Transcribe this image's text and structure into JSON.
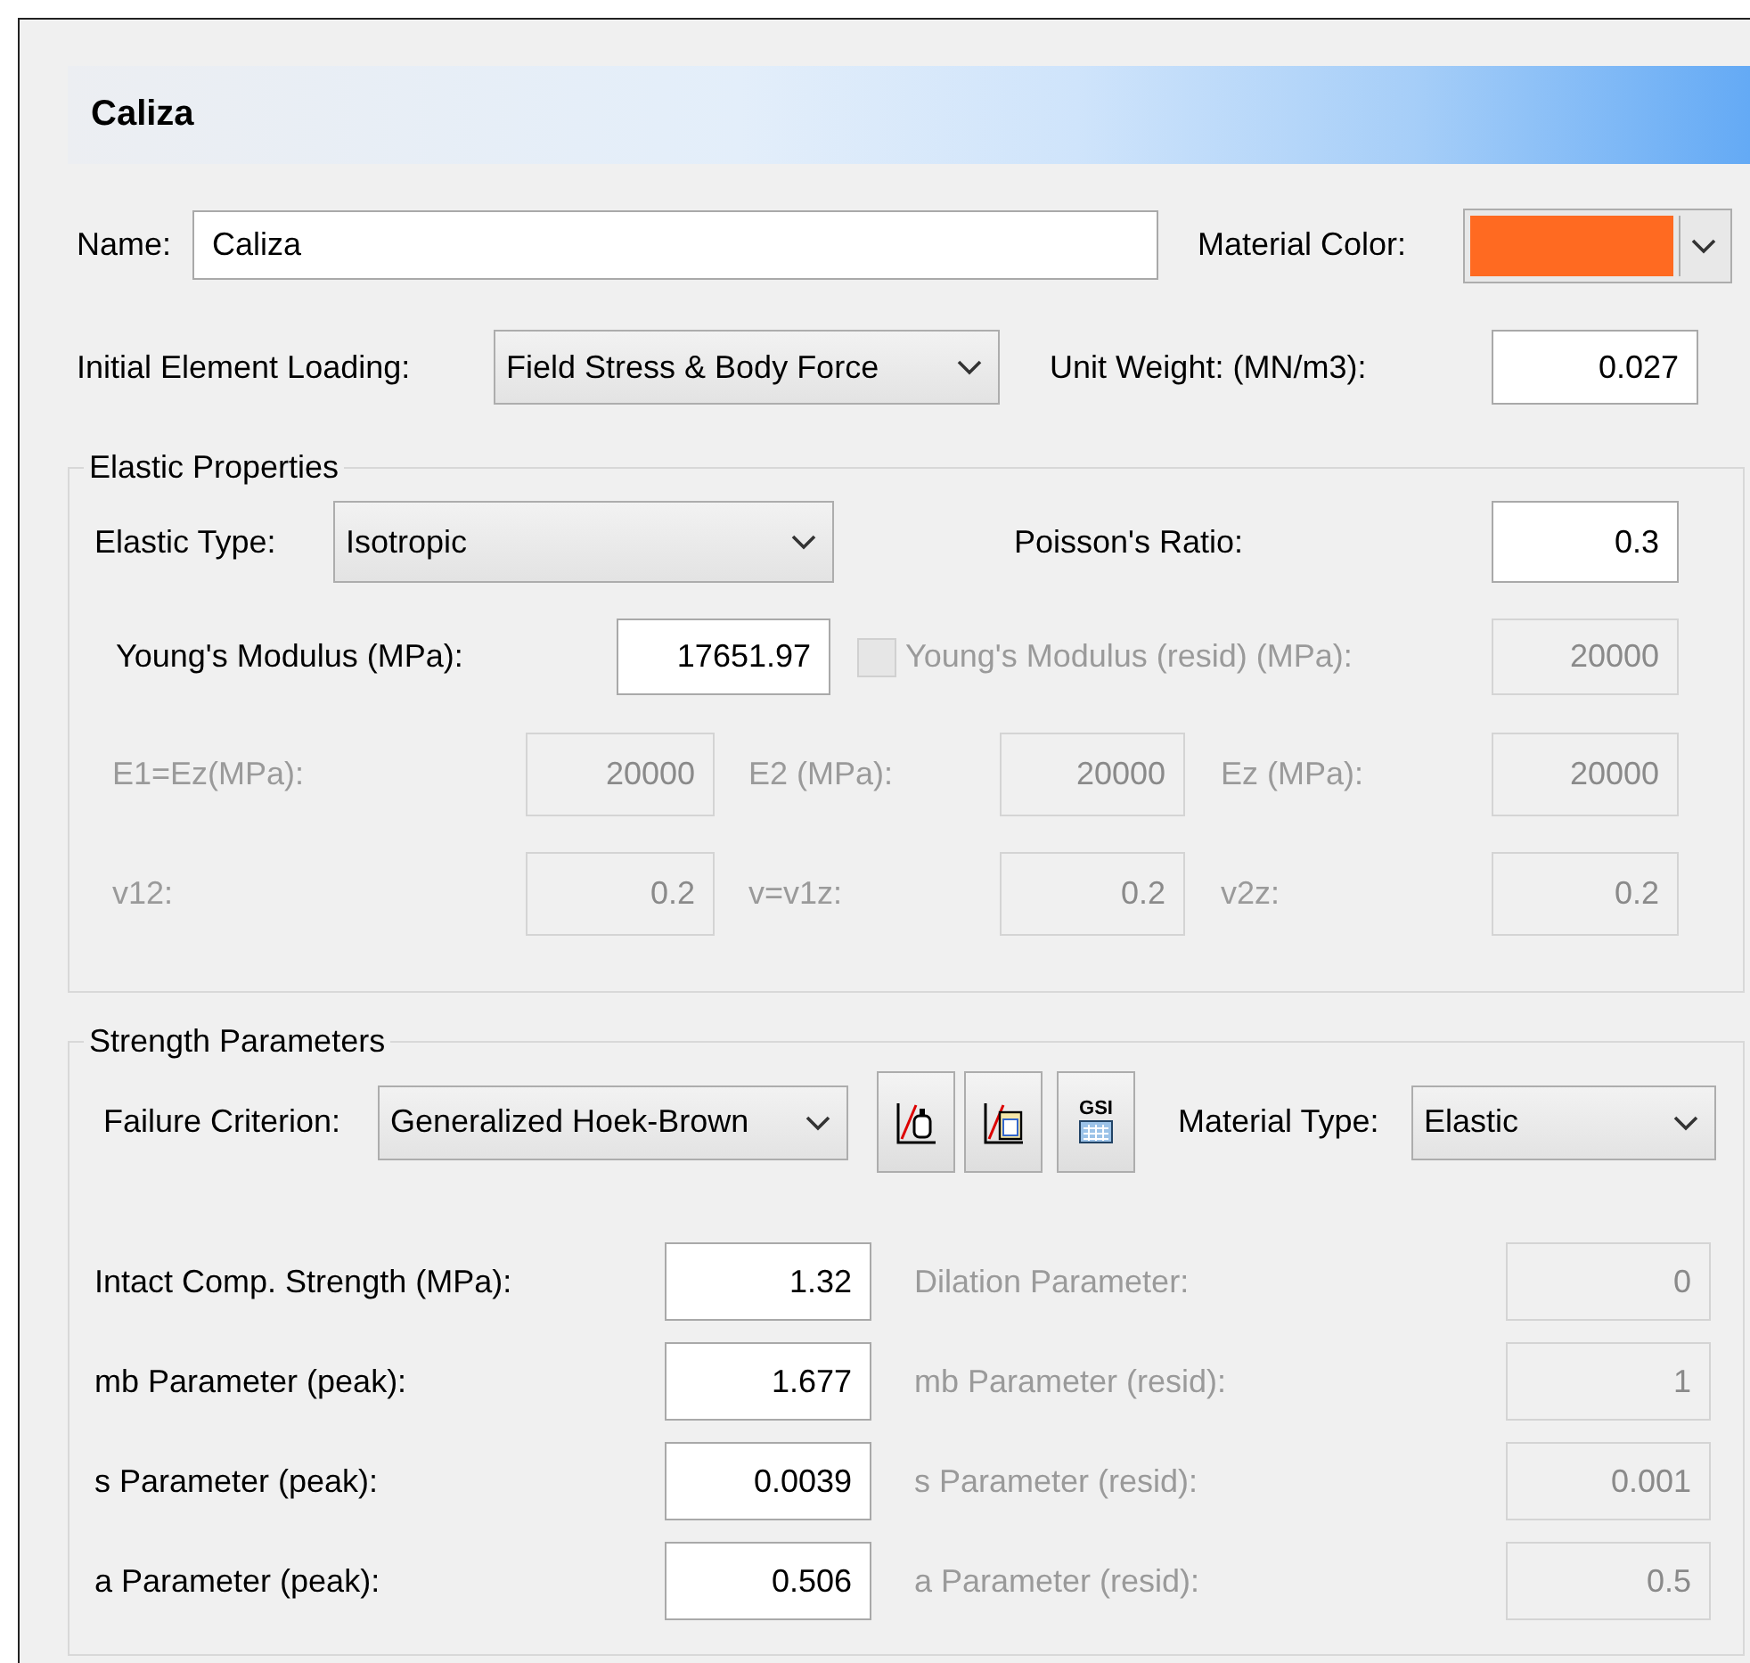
{
  "header": {
    "title": "Caliza"
  },
  "name": {
    "label": "Name:",
    "value": "Caliza"
  },
  "material_color": {
    "label": "Material Color:",
    "color": "#ff6a21"
  },
  "initial_loading": {
    "label": "Initial Element Loading:",
    "value": "Field Stress & Body Force"
  },
  "unit_weight": {
    "label": "Unit Weight: (MN/m3):",
    "value": "0.027"
  },
  "elastic": {
    "title": "Elastic Properties",
    "elastic_type": {
      "label": "Elastic Type:",
      "value": "Isotropic"
    },
    "poisson": {
      "label": "Poisson's Ratio:",
      "value": "0.3"
    },
    "youngs": {
      "label": "Young's Modulus (MPa):",
      "value": "17651.97"
    },
    "youngs_resid": {
      "label": "Young's Modulus (resid) (MPa):",
      "value": "20000",
      "checked": false,
      "disabled": true
    },
    "aniso_fields": [
      {
        "label": "E1=Ez(MPa):",
        "value": "20000",
        "disabled": true
      },
      {
        "label": "E2 (MPa):",
        "value": "20000",
        "disabled": true
      },
      {
        "label": "Ez (MPa):",
        "value": "20000",
        "disabled": true
      },
      {
        "label": "v12:",
        "value": "0.2",
        "disabled": true
      },
      {
        "label": "v=v1z:",
        "value": "0.2",
        "disabled": true
      },
      {
        "label": "v2z:",
        "value": "0.2",
        "disabled": true
      }
    ]
  },
  "strength": {
    "title": "Strength Parameters",
    "failure_criterion": {
      "label": "Failure Criterion:",
      "value": "Generalized Hoek-Brown"
    },
    "tool_buttons": [
      {
        "kind": "graph-sample"
      },
      {
        "kind": "graph-clipboard"
      },
      {
        "kind": "gsi",
        "label": "GSI"
      }
    ],
    "material_type": {
      "label": "Material Type:",
      "value": "Elastic"
    },
    "params": [
      {
        "label": "Intact Comp. Strength (MPa):",
        "value": "1.32",
        "resid": {
          "label": "Dilation Parameter:",
          "value": "0",
          "disabled": true
        }
      },
      {
        "label": "mb Parameter (peak):",
        "value": "1.677",
        "resid": {
          "label": "mb Parameter (resid):",
          "value": "1",
          "disabled": true
        }
      },
      {
        "label": "s Parameter (peak):",
        "value": "0.0039",
        "resid": {
          "label": "s Parameter (resid):",
          "value": "0.001",
          "disabled": true
        }
      },
      {
        "label": "a Parameter (peak):",
        "value": "0.506",
        "resid": {
          "label": "a Parameter (resid):",
          "value": "0.5",
          "disabled": true
        }
      }
    ]
  }
}
